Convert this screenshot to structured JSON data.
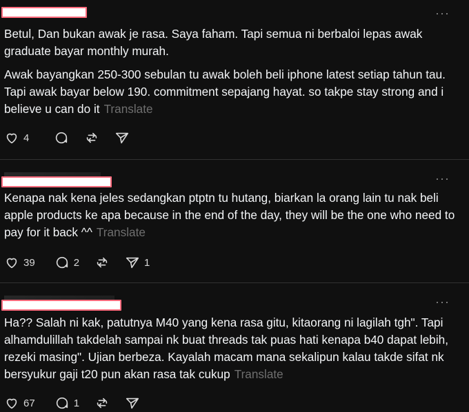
{
  "posts": [
    {
      "paragraphs": [
        "Betul, Dan bukan awak je rasa. Saya faham. Tapi semua ni berbaloi lepas awak graduate bayar monthly murah.",
        "Awak bayangkan 250-300 sebulan tu awak boleh beli iphone latest setiap tahun tau. Tapi awak bayar below 190. commitment sepajang hayat. so takpe stay strong and i believe u can do it"
      ],
      "translate_label": "Translate",
      "likes": "4",
      "replies": "",
      "reposts": "",
      "shares": ""
    },
    {
      "paragraphs": [
        "Kenapa nak kena jeles sedangkan ptptn tu hutang, biarkan la orang lain tu nak beli apple products ke apa because in the end of the day, they will be the one who need to pay for it back ^^"
      ],
      "translate_label": "Translate",
      "likes": "39",
      "replies": "2",
      "reposts": "",
      "shares": "1"
    },
    {
      "paragraphs": [
        "Ha?? Salah ni kak, patutnya M40 yang kena rasa gitu, kitaorang ni lagilah tgh\". Tapi alhamdulillah takdelah sampai nk buat threads tak puas hati kenapa b40 dapat lebih, rezeki masing\". Ujian berbeza. Kayalah macam mana sekalipun kalau takde sifat nk bersyukur gaji t20 pun akan rasa tak cukup"
      ],
      "translate_label": "Translate",
      "likes": "67",
      "replies": "1",
      "reposts": "",
      "shares": ""
    }
  ],
  "more_glyph": "···",
  "colors": {
    "background": "#101010",
    "text": "#f3f5f7",
    "muted": "#6f6f6f",
    "redaction": "#ff6b7d"
  },
  "icons": [
    "heart-icon",
    "comment-icon",
    "repost-icon",
    "share-icon",
    "more-icon"
  ]
}
